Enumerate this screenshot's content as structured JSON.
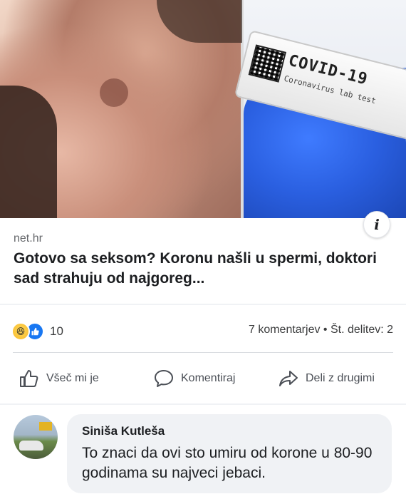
{
  "post": {
    "source_domain": "net.hr",
    "headline": "Gotovo sa seksom? Koronu našli u spermi, doktori sad strahuju od najgoreg...",
    "image_right_text": {
      "title": "COVID-19",
      "subtitle": "Coronavirus lab test"
    },
    "info_icon_glyph": "i"
  },
  "engagement": {
    "reaction_count": "10",
    "stats_text": "7 komentarjev • Št. delitev: 2",
    "reaction_icons": [
      "haha-emoji-icon",
      "like-thumb-icon"
    ]
  },
  "actions": {
    "like_label": "Všeč mi je",
    "comment_label": "Komentiraj",
    "share_label": "Deli z drugimi"
  },
  "comment": {
    "author": "Siniša Kutleša",
    "text": "To znaci da ovi sto umiru od korone u 80-90 godinama su najveci jebaci."
  },
  "colors": {
    "like_blue": "#1877f2",
    "haha_yellow": "#f7b928",
    "bubble_bg": "#f0f2f5",
    "text_secondary": "#65676b"
  }
}
